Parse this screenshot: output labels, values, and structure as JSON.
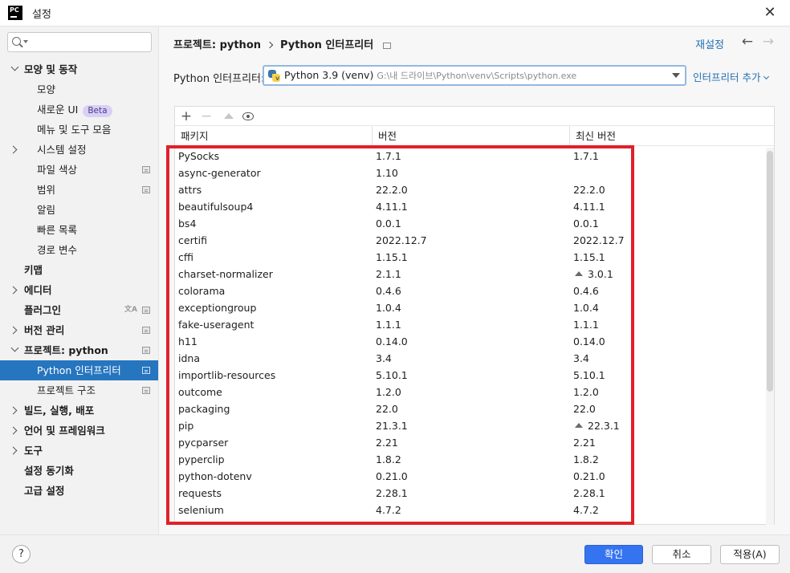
{
  "window": {
    "title": "설정",
    "logo": "PC"
  },
  "sidebar": {
    "search_placeholder": "",
    "items": [
      {
        "label": "모양 및 동작",
        "level": 0,
        "bold": true,
        "chevron": "down"
      },
      {
        "label": "모양",
        "level": 1
      },
      {
        "label": "새로운 UI",
        "level": 1,
        "badge": "Beta"
      },
      {
        "label": "메뉴 및 도구 모음",
        "level": 1
      },
      {
        "label": "시스템 설정",
        "level": 1,
        "chevron": "right"
      },
      {
        "label": "파일 색상",
        "level": 1,
        "project_icon": true
      },
      {
        "label": "범위",
        "level": 1,
        "project_icon": true
      },
      {
        "label": "알림",
        "level": 1
      },
      {
        "label": "빠른 목록",
        "level": 1
      },
      {
        "label": "경로 변수",
        "level": 1
      },
      {
        "label": "키맵",
        "level": 0,
        "bold": true
      },
      {
        "label": "에디터",
        "level": 0,
        "bold": true,
        "chevron": "right"
      },
      {
        "label": "플러그인",
        "level": 0,
        "bold": true,
        "translate_icon": true,
        "project_icon": true
      },
      {
        "label": "버전 관리",
        "level": 0,
        "bold": true,
        "chevron": "right",
        "project_icon": true
      },
      {
        "label": "프로젝트: python",
        "level": 0,
        "bold": true,
        "chevron": "down",
        "project_icon": true
      },
      {
        "label": "Python 인터프리터",
        "level": 1,
        "selected": true,
        "project_icon": true
      },
      {
        "label": "프로젝트 구조",
        "level": 1,
        "project_icon": true
      },
      {
        "label": "빌드, 실행, 배포",
        "level": 0,
        "bold": true,
        "chevron": "right"
      },
      {
        "label": "언어 및 프레임워크",
        "level": 0,
        "bold": true,
        "chevron": "right"
      },
      {
        "label": "도구",
        "level": 0,
        "bold": true,
        "chevron": "right"
      },
      {
        "label": "설정 동기화",
        "level": 0,
        "bold": true
      },
      {
        "label": "고급 설정",
        "level": 0,
        "bold": true
      }
    ]
  },
  "header": {
    "breadcrumb_project": "프로젝트: python",
    "breadcrumb_page": "Python 인터프리터",
    "reset_label": "재설정"
  },
  "interpreter": {
    "label": "Python 인터프리터:",
    "value": "Python 3.9 (venv)",
    "path": "G:\\내 드라이브\\Python\\venv\\Scripts\\python.exe",
    "add_label": "인터프리터 추가"
  },
  "table": {
    "columns": [
      "패키지",
      "버전",
      "최신 버전"
    ],
    "rows": [
      {
        "package": "PySocks",
        "version": "1.7.1",
        "latest": "1.7.1",
        "upgrade": false
      },
      {
        "package": "async-generator",
        "version": "1.10",
        "latest": "",
        "upgrade": false
      },
      {
        "package": "attrs",
        "version": "22.2.0",
        "latest": "22.2.0",
        "upgrade": false
      },
      {
        "package": "beautifulsoup4",
        "version": "4.11.1",
        "latest": "4.11.1",
        "upgrade": false
      },
      {
        "package": "bs4",
        "version": "0.0.1",
        "latest": "0.0.1",
        "upgrade": false
      },
      {
        "package": "certifi",
        "version": "2022.12.7",
        "latest": "2022.12.7",
        "upgrade": false
      },
      {
        "package": "cffi",
        "version": "1.15.1",
        "latest": "1.15.1",
        "upgrade": false
      },
      {
        "package": "charset-normalizer",
        "version": "2.1.1",
        "latest": "3.0.1",
        "upgrade": true
      },
      {
        "package": "colorama",
        "version": "0.4.6",
        "latest": "0.4.6",
        "upgrade": false
      },
      {
        "package": "exceptiongroup",
        "version": "1.0.4",
        "latest": "1.0.4",
        "upgrade": false
      },
      {
        "package": "fake-useragent",
        "version": "1.1.1",
        "latest": "1.1.1",
        "upgrade": false
      },
      {
        "package": "h11",
        "version": "0.14.0",
        "latest": "0.14.0",
        "upgrade": false
      },
      {
        "package": "idna",
        "version": "3.4",
        "latest": "3.4",
        "upgrade": false
      },
      {
        "package": "importlib-resources",
        "version": "5.10.1",
        "latest": "5.10.1",
        "upgrade": false
      },
      {
        "package": "outcome",
        "version": "1.2.0",
        "latest": "1.2.0",
        "upgrade": false
      },
      {
        "package": "packaging",
        "version": "22.0",
        "latest": "22.0",
        "upgrade": false
      },
      {
        "package": "pip",
        "version": "21.3.1",
        "latest": "22.3.1",
        "upgrade": true
      },
      {
        "package": "pycparser",
        "version": "2.21",
        "latest": "2.21",
        "upgrade": false
      },
      {
        "package": "pyperclip",
        "version": "1.8.2",
        "latest": "1.8.2",
        "upgrade": false
      },
      {
        "package": "python-dotenv",
        "version": "0.21.0",
        "latest": "0.21.0",
        "upgrade": false
      },
      {
        "package": "requests",
        "version": "2.28.1",
        "latest": "2.28.1",
        "upgrade": false
      },
      {
        "package": "selenium",
        "version": "4.7.2",
        "latest": "4.7.2",
        "upgrade": false
      }
    ]
  },
  "footer": {
    "help": "?",
    "ok_label": "확인",
    "cancel_label": "취소",
    "apply_label": "적용(A)"
  },
  "colors": {
    "accent": "#2675bf",
    "primary_button": "#3574f0",
    "link": "#2470b3",
    "highlight_box": "#e0202a"
  }
}
